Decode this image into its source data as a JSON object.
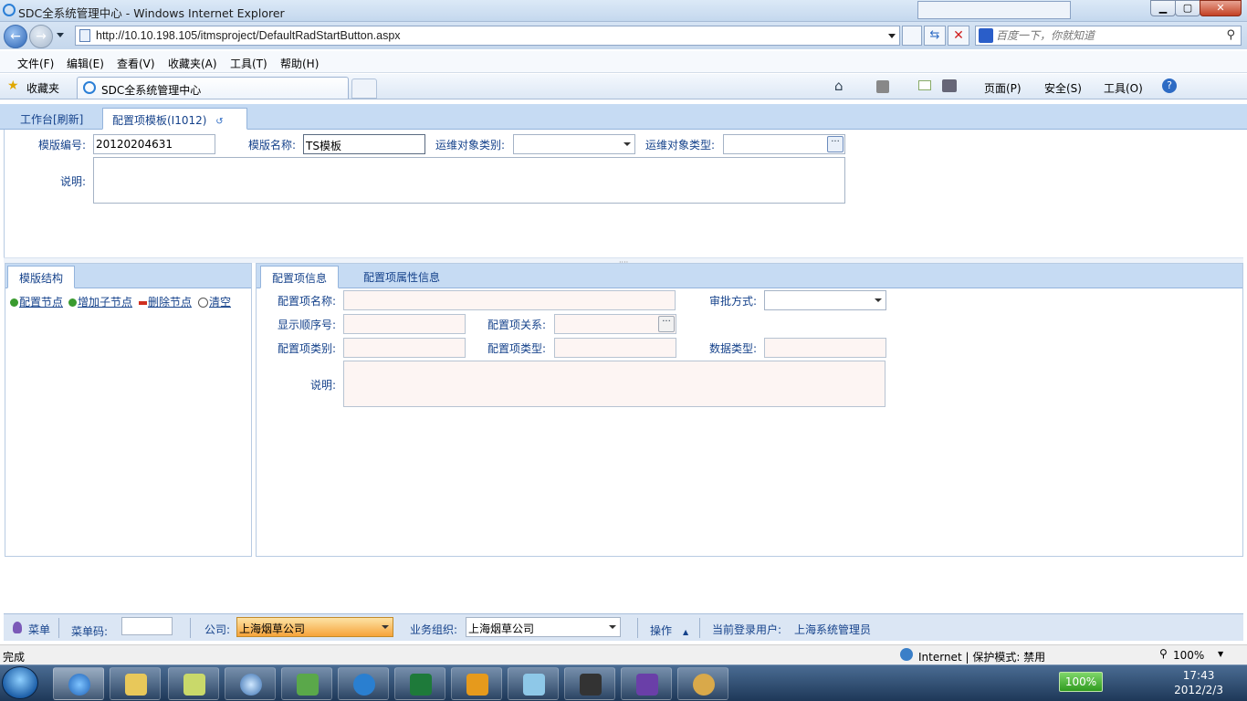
{
  "window": {
    "title": "SDC全系统管理中心 - Windows Internet Explorer",
    "url": "http://10.10.198.105/itmsproject/DefaultRadStartButton.aspx",
    "search_placeholder": "百度一下，你就知道"
  },
  "menu": [
    "文件(F)",
    "编辑(E)",
    "查看(V)",
    "收藏夹(A)",
    "工具(T)",
    "帮助(H)"
  ],
  "favbar": {
    "favorites": "收藏夹",
    "tab_title": "SDC全系统管理中心",
    "cmd_page": "页面(P)",
    "cmd_safety": "安全(S)",
    "cmd_tools": "工具(O)"
  },
  "app_tabs": {
    "workbench": "工作台[刷新]",
    "template": "配置项模板(I1012)"
  },
  "template_form": {
    "code_label": "模版编号:",
    "code_value": "20120204631",
    "name_label": "模版名称:",
    "name_value": "TS模板",
    "ops_category_label": "运维对象类别:",
    "ops_category_value": "",
    "ops_type_label": "运维对象类型:",
    "ops_type_value": "",
    "desc_label": "说明:",
    "desc_value": ""
  },
  "left_panel": {
    "tab": "模版结构",
    "tools": [
      "配置节点",
      "增加子节点",
      "删除节点",
      "清空"
    ]
  },
  "right_panel": {
    "tab_info": "配置项信息",
    "tab_attr": "配置项属性信息",
    "item_name_label": "配置项名称:",
    "approve_label": "审批方式:",
    "order_label": "显示顺序号:",
    "relation_label": "配置项关系:",
    "category_label": "配置项类别:",
    "type_label": "配置项类型:",
    "data_type_label": "数据类型:",
    "desc_label": "说明:"
  },
  "app_status": {
    "menu": "菜单",
    "menu_code_label": "菜单码:",
    "company_label": "公司:",
    "company_value": "上海烟草公司",
    "org_label": "业务组织:",
    "org_value": "上海烟草公司",
    "ops": "操作",
    "user_label": "当前登录用户:",
    "user_value": "上海系统管理员"
  },
  "ie_status": {
    "done": "完成",
    "zone": "Internet | 保护模式: 禁用",
    "zoom": "100%"
  },
  "taskbar": {
    "battery": "100%",
    "time": "17:43",
    "date": "2012/2/3"
  }
}
